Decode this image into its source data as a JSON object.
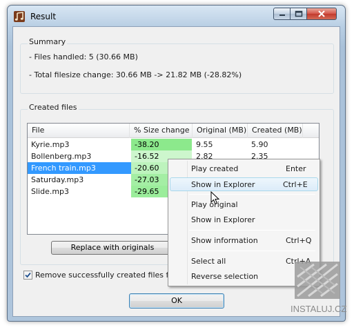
{
  "window": {
    "title": "Result"
  },
  "summary": {
    "label": "Summary",
    "files_handled": "- Files handled: 5  (30.66 MB)",
    "total_change": "- Total filesize change: 30.66 MB -> 21.82 MB  (-28.82%)"
  },
  "created_files": {
    "label": "Created files",
    "columns": [
      "File",
      "% Size change",
      "Original  (MB)",
      "Created  (MB)"
    ],
    "rows": [
      {
        "file": "Kyrie.mp3",
        "change": "-38.20",
        "original": "9.55",
        "created": "5.90",
        "change_color": "#8ce98c"
      },
      {
        "file": "Bollenberg.mp3",
        "change": "-16.52",
        "original": "2.82",
        "created": "2.35",
        "change_color": "#cdf6cd"
      },
      {
        "file": "French train.mp3",
        "change": "-20.60",
        "original": "",
        "created": "",
        "change_color": "#bdf3bd"
      },
      {
        "file": "Saturday.mp3",
        "change": "-27.03",
        "original": "",
        "created": "",
        "change_color": "#a4eea4"
      },
      {
        "file": "Slide.mp3",
        "change": "-29.65",
        "original": "",
        "created": "",
        "change_color": "#9bed9b"
      }
    ],
    "selected_row": 2
  },
  "buttons": {
    "replace": "Replace with originals",
    "ok": "OK"
  },
  "checkbox": {
    "label": "Remove successfully created files from m",
    "checked": true
  },
  "context_menu": {
    "items": [
      {
        "label": "Play created",
        "shortcut": "Enter"
      },
      {
        "label": "Show in Explorer",
        "shortcut": "Ctrl+E"
      },
      {
        "label": "Play original",
        "shortcut": ""
      },
      {
        "label": "Show in Explorer",
        "shortcut": ""
      },
      {
        "label": "Show information",
        "shortcut": "Ctrl+Q"
      },
      {
        "label": "Select all",
        "shortcut": "Ctrl+A"
      },
      {
        "label": "Reverse selection",
        "shortcut": ""
      }
    ],
    "highlighted_index": 1
  },
  "watermark": {
    "text": "INSTALUJ.CZ"
  }
}
